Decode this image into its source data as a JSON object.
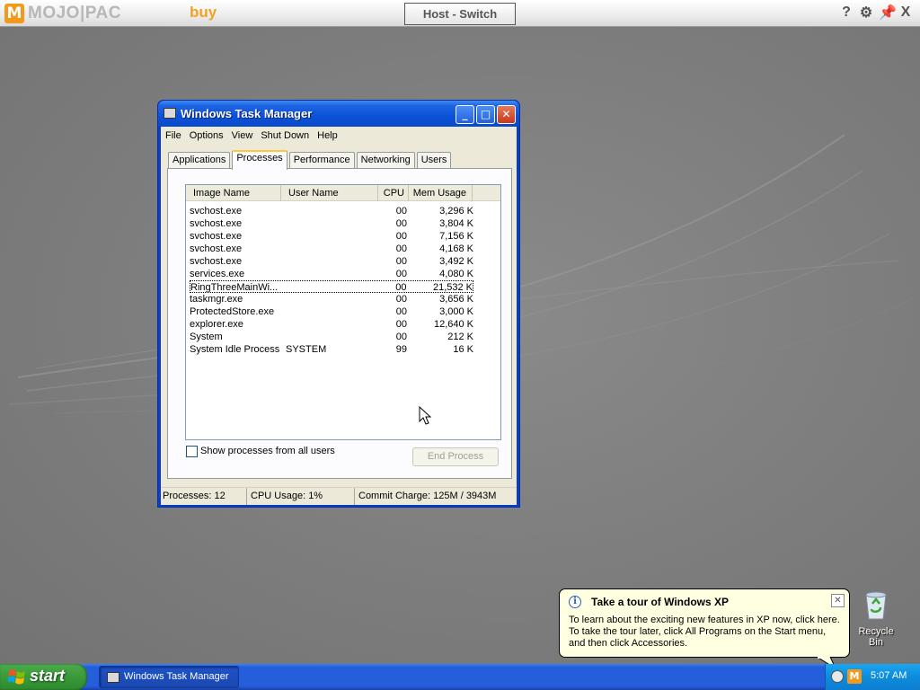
{
  "mojopac": {
    "logo_m": "M",
    "logo_text": "MOJO|PAC",
    "buy_label": "buy",
    "host_switch_label": "Host - Switch",
    "help_label": "?",
    "close_label": "X"
  },
  "task_manager": {
    "title": "Windows Task Manager",
    "menu": [
      "File",
      "Options",
      "View",
      "Shut Down",
      "Help"
    ],
    "tabs": [
      "Applications",
      "Processes",
      "Performance",
      "Networking",
      "Users"
    ],
    "active_tab": "Processes",
    "columns": [
      "Image Name",
      "User Name",
      "CPU",
      "Mem Usage"
    ],
    "processes": [
      {
        "name": "svchost.exe",
        "user": "",
        "cpu": "00",
        "mem": "3,296 K"
      },
      {
        "name": "svchost.exe",
        "user": "",
        "cpu": "00",
        "mem": "3,804 K"
      },
      {
        "name": "svchost.exe",
        "user": "",
        "cpu": "00",
        "mem": "7,156 K"
      },
      {
        "name": "svchost.exe",
        "user": "",
        "cpu": "00",
        "mem": "4,168 K"
      },
      {
        "name": "svchost.exe",
        "user": "",
        "cpu": "00",
        "mem": "3,492 K"
      },
      {
        "name": "services.exe",
        "user": "",
        "cpu": "00",
        "mem": "4,080 K"
      },
      {
        "name": "RingThreeMainWi...",
        "user": "",
        "cpu": "00",
        "mem": "21,532 K"
      },
      {
        "name": "taskmgr.exe",
        "user": "",
        "cpu": "00",
        "mem": "3,656 K"
      },
      {
        "name": "ProtectedStore.exe",
        "user": "",
        "cpu": "00",
        "mem": "3,000 K"
      },
      {
        "name": "explorer.exe",
        "user": "",
        "cpu": "00",
        "mem": "12,640 K"
      },
      {
        "name": "System",
        "user": "",
        "cpu": "00",
        "mem": "212 K"
      },
      {
        "name": "System Idle Process",
        "user": "SYSTEM",
        "cpu": "99",
        "mem": "16 K"
      }
    ],
    "show_all_label": "Show processes from all users",
    "end_process_label": "End Process",
    "status": {
      "processes": "Processes: 12",
      "cpu": "CPU Usage: 1%",
      "commit": "Commit Charge: 125M / 3943M"
    }
  },
  "desktop": {
    "recycle_bin_label": "Recycle Bin"
  },
  "balloon": {
    "title": "Take a tour of Windows XP",
    "line1": "To learn about the exciting new features in XP now, click here.",
    "line2": "To take the tour later, click All Programs on the Start menu,",
    "line3": "and then click Accessories."
  },
  "taskbar": {
    "start_label": "start",
    "task_label": "Windows Task Manager",
    "clock": "5:07 AM"
  },
  "colors": {
    "xp_blue": "#245edb",
    "start_green": "#3a9a3a",
    "mojo_orange": "#f19a1e",
    "balloon_yellow": "#ffffe1"
  }
}
